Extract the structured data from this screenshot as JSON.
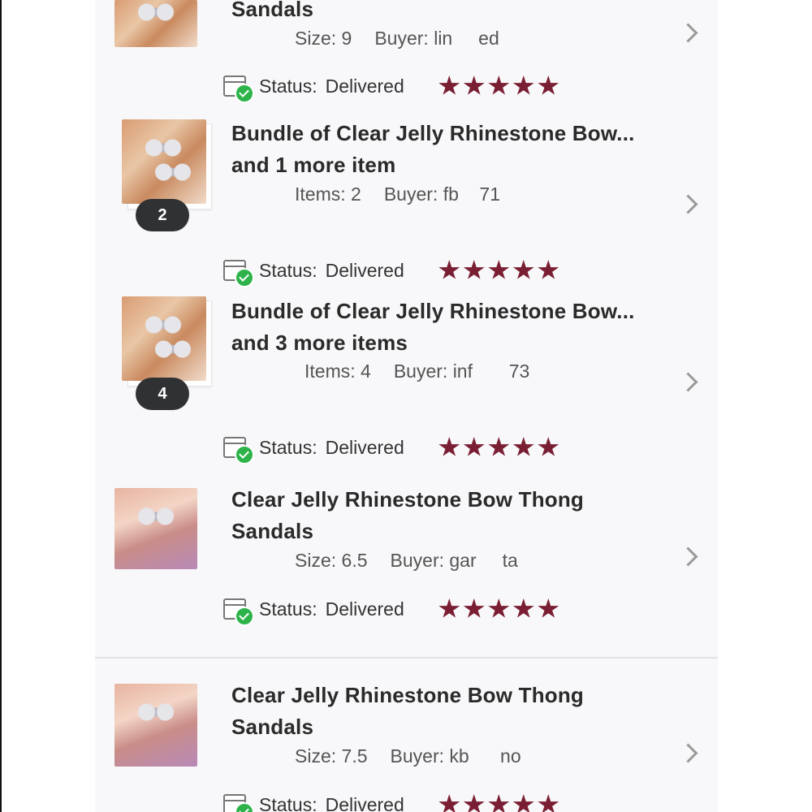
{
  "labels": {
    "status_label": "Status:",
    "size_label": "Size:",
    "items_label": "Items:",
    "buyer_label": "Buyer:"
  },
  "colors": {
    "star": "#7a1f33",
    "delivered_check": "#2db34a"
  },
  "orders": [
    {
      "title_lines": [
        "Sandals"
      ],
      "detail_value": "9",
      "buyer": "lin     ed",
      "status": "Delivered",
      "rating": 5
    },
    {
      "title_lines": [
        "Bundle of Clear Jelly Rhinestone Bow...",
        "and 1 more item"
      ],
      "detail_value": "2",
      "buyer": "fb    71",
      "badge": "2",
      "status": "Delivered",
      "rating": 5
    },
    {
      "title_lines": [
        "Bundle of Clear Jelly Rhinestone Bow...",
        "and 3 more items"
      ],
      "detail_value": "4",
      "buyer": "inf       73",
      "badge": "4",
      "status": "Delivered",
      "rating": 5
    },
    {
      "title_lines": [
        "Clear Jelly Rhinestone Bow Thong",
        "Sandals"
      ],
      "detail_value": "6.5",
      "buyer": "gar     ta",
      "status": "Delivered",
      "rating": 5
    },
    {
      "title_lines": [
        "Clear Jelly Rhinestone Bow Thong",
        "Sandals"
      ],
      "detail_value": "7.5",
      "buyer": "kb      no",
      "status": "Delivered",
      "rating": 5
    }
  ]
}
